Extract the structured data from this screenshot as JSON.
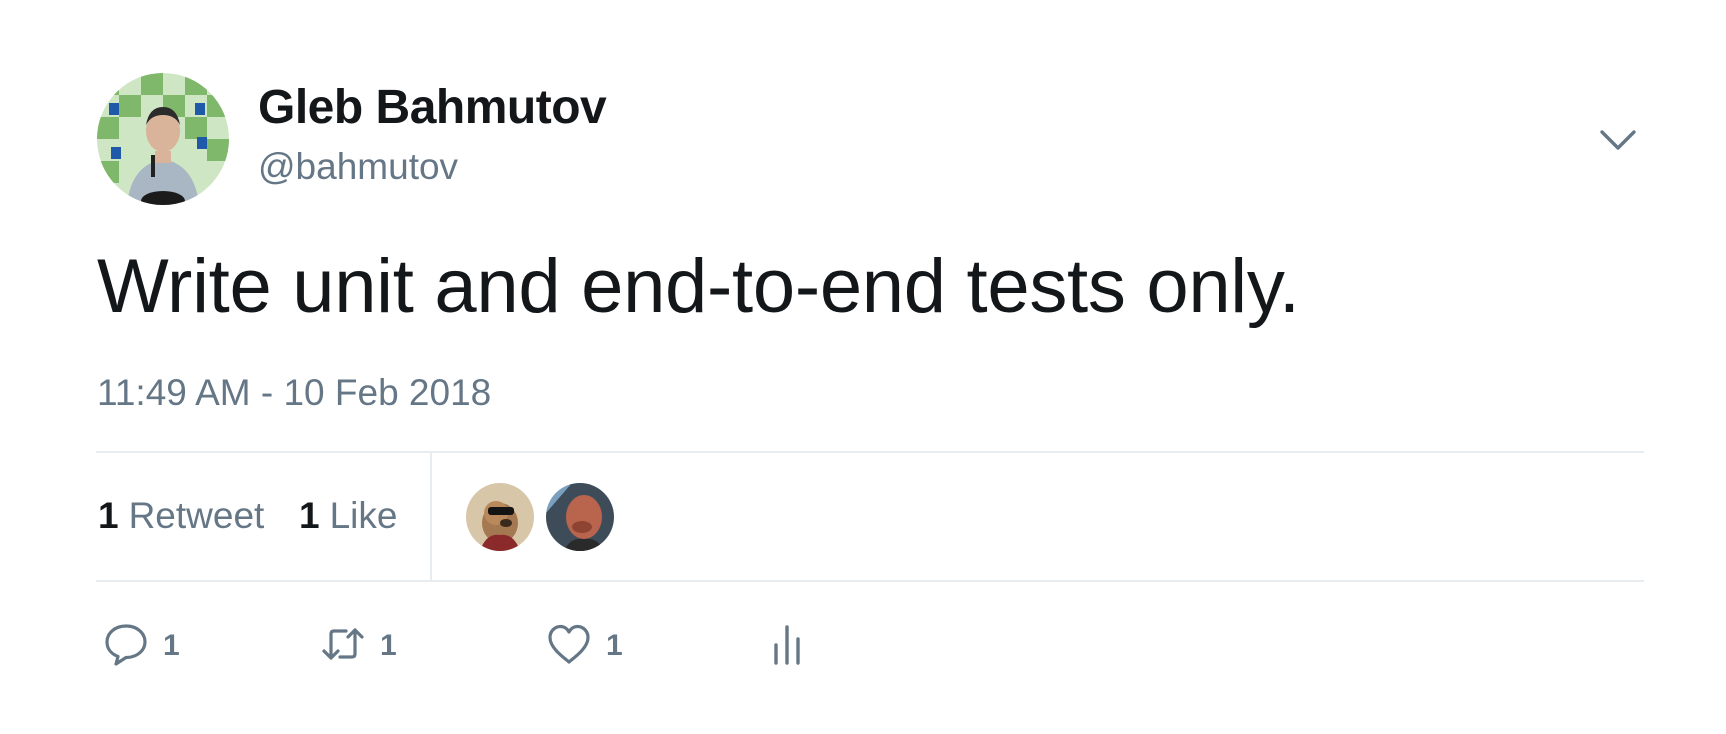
{
  "author": {
    "name": "Gleb Bahmutov",
    "handle": "@bahmutov"
  },
  "tweet": {
    "text": "Write unit and end-to-end tests only.",
    "timestamp": "11:49 AM - 10 Feb 2018"
  },
  "stats": {
    "retweet_count": "1",
    "retweet_label": "Retweet",
    "like_count": "1",
    "like_label": "Like"
  },
  "actions": {
    "reply_count": "1",
    "retweet_count": "1",
    "like_count": "1"
  },
  "colors": {
    "text_primary": "#14171a",
    "text_secondary": "#657786",
    "divider": "#e6ecf0"
  },
  "icons": [
    "chevron-down-icon",
    "reply-icon",
    "retweet-icon",
    "heart-icon",
    "analytics-icon"
  ]
}
